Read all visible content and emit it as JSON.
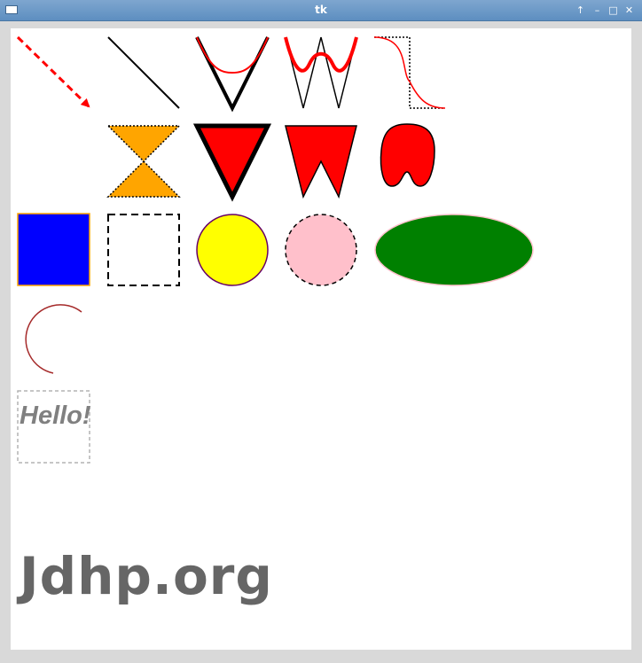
{
  "window": {
    "title": "tk",
    "buttons": {
      "pin": "↑",
      "minimize": "–",
      "maximize": "□",
      "close": "✕"
    }
  },
  "canvas": {
    "background": "#ffffff",
    "text_item": "Hello!",
    "logo_text": "Jdhp.org"
  },
  "colors": {
    "red": "#ff0000",
    "orange": "#ffa500",
    "blue": "#0000ff",
    "yellow": "#ffff00",
    "pink": "#ffc0cb",
    "green": "#008000",
    "gray": "#808080",
    "logo": "#666666"
  }
}
